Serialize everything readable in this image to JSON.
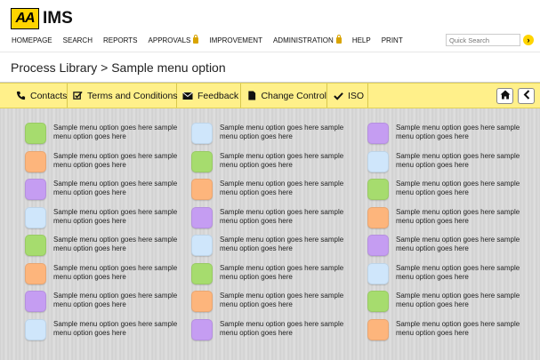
{
  "header": {
    "logo_mark": "AA",
    "logo_text": "IMS",
    "nav": [
      {
        "label": "HOMEPAGE",
        "locked": false
      },
      {
        "label": "SEARCH",
        "locked": false
      },
      {
        "label": "REPORTS",
        "locked": false
      },
      {
        "label": "APPROVALS",
        "locked": true
      },
      {
        "label": "IMPROVEMENT",
        "locked": false
      },
      {
        "label": "ADMINISTRATION",
        "locked": true
      },
      {
        "label": "HELP",
        "locked": false
      },
      {
        "label": "PRINT",
        "locked": false
      }
    ],
    "search_placeholder": "Quick Search"
  },
  "page_title": "Process Library > Sample menu option",
  "toolbar": {
    "items": [
      {
        "label": "Contacts",
        "icon": "phone-icon"
      },
      {
        "label": "Terms and Conditions",
        "icon": "checkbox-icon"
      },
      {
        "label": "Feedback",
        "icon": "envelope-icon"
      },
      {
        "label": "Change Control",
        "icon": "document-icon"
      },
      {
        "label": "ISO",
        "icon": "check-icon"
      }
    ],
    "right_buttons": [
      "home-icon",
      "back-icon"
    ]
  },
  "colors": {
    "green": "#a6dc6e",
    "orange": "#fdb57c",
    "purple": "#c59df2",
    "blue": "#cfe6fb",
    "brand_yellow": "#ffd400",
    "toolbar_yellow": "#fff08a"
  },
  "menu": {
    "label": "Sample menu option goes here sample menu option goes here",
    "columns": [
      [
        "green",
        "orange",
        "purple",
        "blue",
        "green",
        "orange",
        "purple",
        "blue"
      ],
      [
        "blue",
        "green",
        "orange",
        "purple",
        "blue",
        "green",
        "orange",
        "purple"
      ],
      [
        "purple",
        "blue",
        "green",
        "orange",
        "purple",
        "blue",
        "green",
        "orange"
      ]
    ]
  }
}
